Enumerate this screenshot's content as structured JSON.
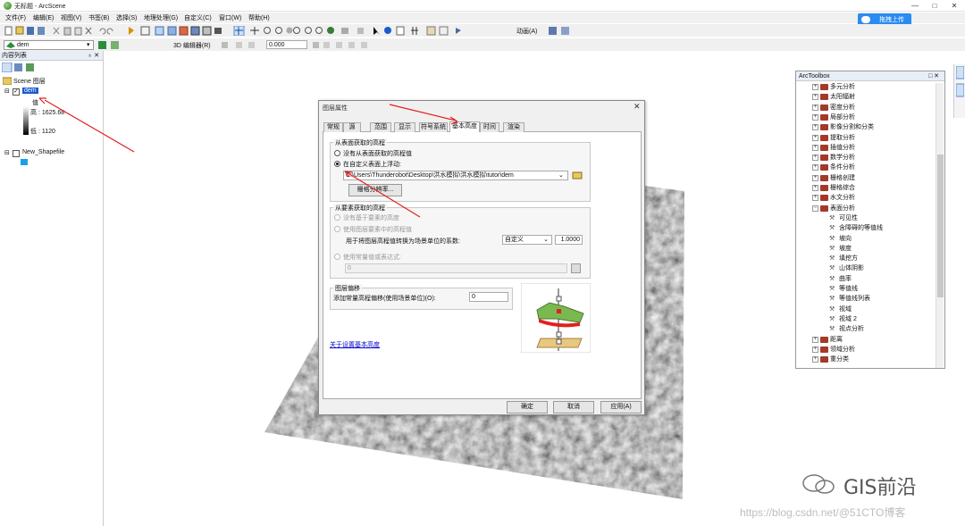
{
  "window": {
    "title": "无标题 - ArcScene",
    "controls": [
      "—",
      "□",
      "✕"
    ]
  },
  "menu": [
    "文件(F)",
    "编辑(E)",
    "视图(V)",
    "书签(B)",
    "选择(S)",
    "地理处理(G)",
    "自定义(C)",
    "窗口(W)",
    "帮助(H)"
  ],
  "cloud_button": "拖拽上传",
  "toolbar": {
    "layer_select": "dem",
    "editor_label": "3D 编辑器(R)",
    "coord_value": "0.000",
    "animation_label": "动画(A)"
  },
  "toc": {
    "title": "内容列表",
    "pin": "♁ ✕",
    "scene_label": "Scene 图层",
    "layers": [
      {
        "name": "dem",
        "checked": true,
        "legend_title": "值",
        "high": "高 : 1625.68",
        "low": "低 : 1120"
      },
      {
        "name": "New_Shapefile",
        "checked": false
      }
    ]
  },
  "dialog": {
    "title": "图层属性",
    "close": "✕",
    "tabs": [
      "常规",
      "源",
      "范围",
      "显示",
      "符号系统",
      "基本高度",
      "时间",
      "渲染"
    ],
    "active_tab": "基本高度",
    "surface_group": "从表面获取的高程",
    "radio_none": "没有从表面获取的高程值",
    "radio_custom": "在自定义表面上浮动:",
    "surface_path": "C:\\Users\\Thunderobot\\Desktop\\洪水模拟\\洪水模拟\\tutor\\dem",
    "raster_res_button": "栅格分辨率...",
    "feature_group": "从要素获取的高程",
    "radio_no_feature": "没有基于要素的高度",
    "radio_use_feature": "使用图层要素中的高程值",
    "factor_label": "用于将图层高程值转换为场景单位的系数:",
    "factor_select": "自定义",
    "factor_value": "1.0000",
    "expr_label": "使用常量值或表达式:",
    "expr_value": "0",
    "offset_group": "图层偏移",
    "offset_label": "添加常量高程偏移(使用场景单位)(O):",
    "offset_value": "0",
    "about_link": "关于设置基本高度",
    "ok": "确定",
    "cancel": "取消",
    "apply": "应用(A)"
  },
  "toolbox": {
    "title": "ArcToolbox",
    "items": [
      {
        "label": "多元分析",
        "expanded": false
      },
      {
        "label": "太阳辐射",
        "expanded": false
      },
      {
        "label": "密度分析",
        "expanded": false
      },
      {
        "label": "局部分析",
        "expanded": false
      },
      {
        "label": "影像分割和分类",
        "expanded": false
      },
      {
        "label": "提取分析",
        "expanded": false
      },
      {
        "label": "插值分析",
        "expanded": false
      },
      {
        "label": "数学分析",
        "expanded": false
      },
      {
        "label": "条件分析",
        "expanded": false
      },
      {
        "label": "栅格创建",
        "expanded": false
      },
      {
        "label": "栅格综合",
        "expanded": false
      },
      {
        "label": "水文分析",
        "expanded": false
      },
      {
        "label": "表面分析",
        "expanded": true
      },
      {
        "label": "可见性",
        "tool": true
      },
      {
        "label": "含障碍的等值线",
        "tool": true
      },
      {
        "label": "坡向",
        "tool": true
      },
      {
        "label": "坡度",
        "tool": true
      },
      {
        "label": "填挖方",
        "tool": true
      },
      {
        "label": "山体阴影",
        "tool": true
      },
      {
        "label": "曲率",
        "tool": true
      },
      {
        "label": "等值线",
        "tool": true
      },
      {
        "label": "等值线列表",
        "tool": true
      },
      {
        "label": "视域",
        "tool": true
      },
      {
        "label": "视域 2",
        "tool": true
      },
      {
        "label": "视点分析",
        "tool": true
      },
      {
        "label": "距离",
        "expanded": false
      },
      {
        "label": "领域分析",
        "expanded": false
      },
      {
        "label": "重分类",
        "expanded": false
      }
    ]
  },
  "watermark": {
    "brand": "GIS前沿",
    "csdn": "https://blog.csdn.net/@51CTO博客"
  },
  "colors": {
    "accent": "#2a8bf2",
    "arrow": "#e02020",
    "dialog_bg": "#f0f0f0"
  }
}
